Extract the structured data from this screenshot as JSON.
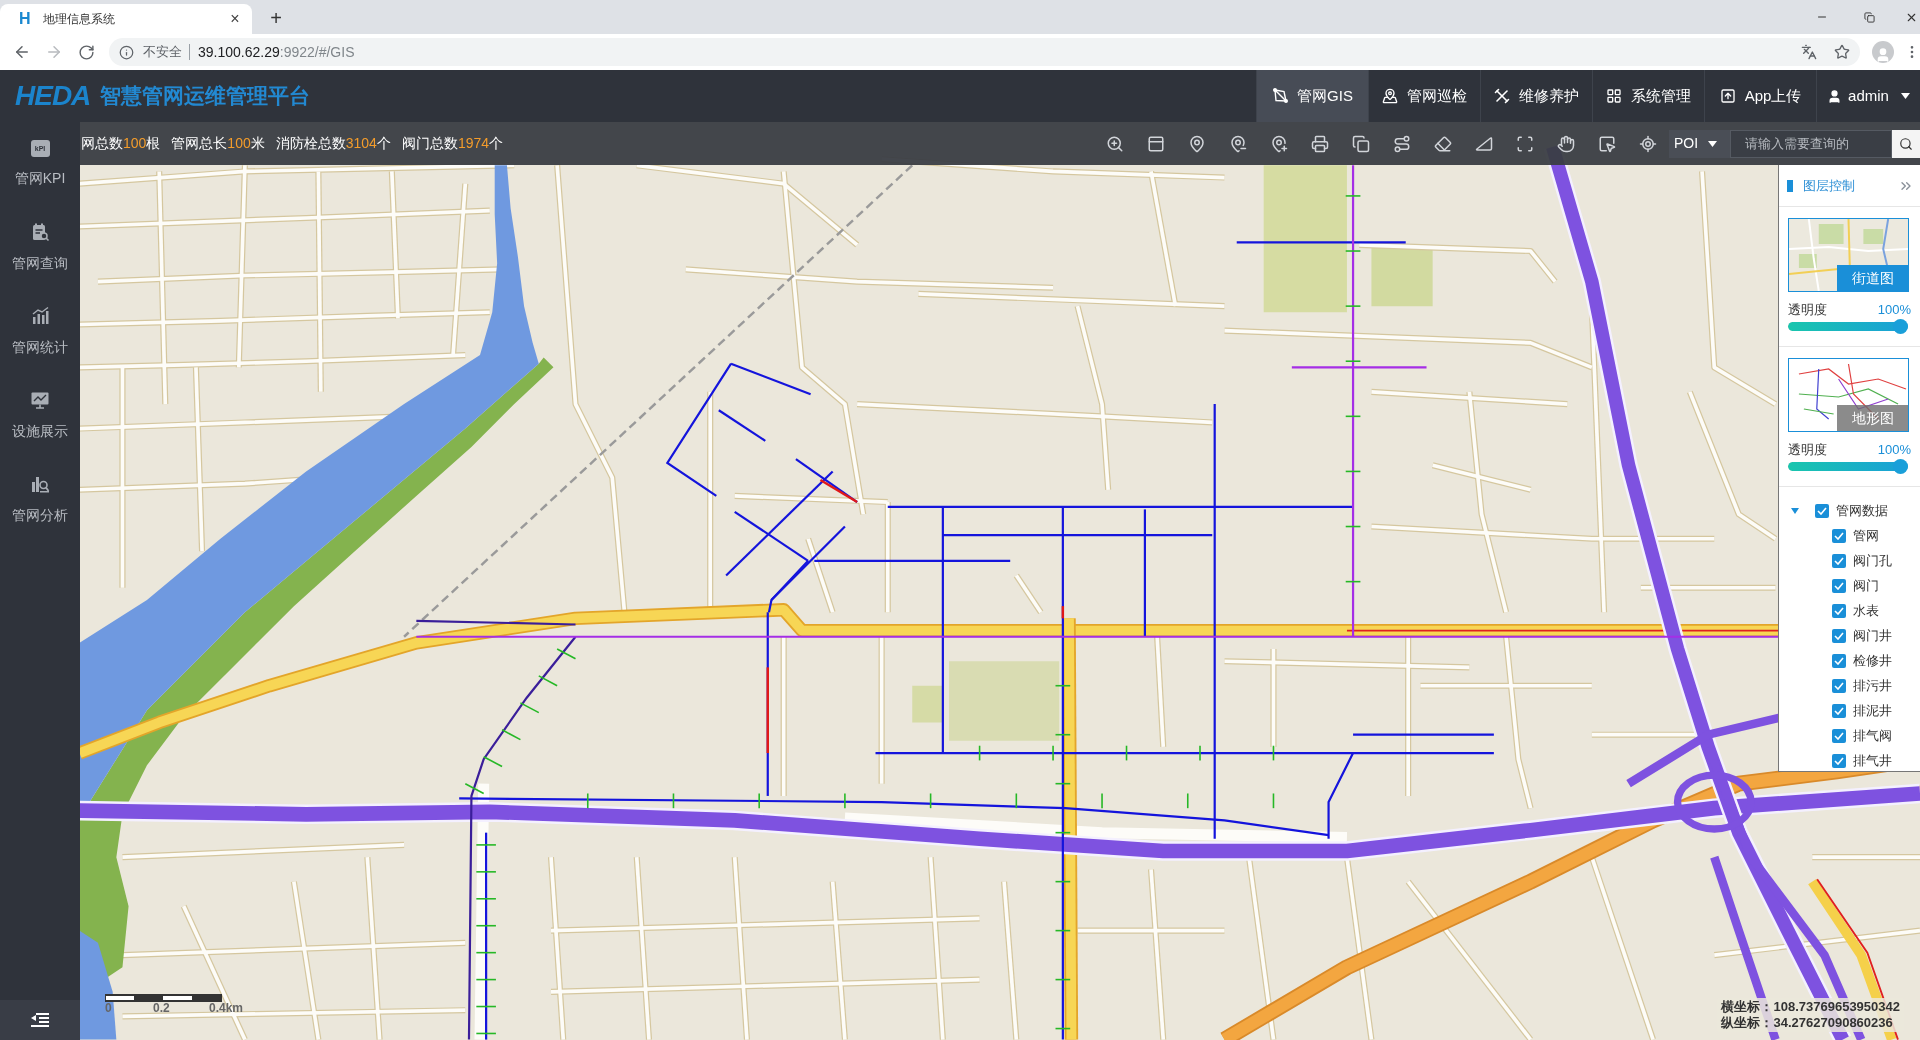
{
  "browser": {
    "tab": {
      "icon_letter": "H",
      "title": "地理信息系统",
      "close": "×",
      "selected": true
    },
    "new_tab": "+",
    "nav_buttons": [
      {
        "kind": "back",
        "disabled": false
      },
      {
        "kind": "forward",
        "disabled": true
      },
      {
        "kind": "reload",
        "disabled": false
      }
    ],
    "address": {
      "security": "不安全",
      "host": "39.100.62.29",
      "path": ":9922/#/GIS"
    }
  },
  "header": {
    "logo": "HEDA",
    "title": "智慧管网运维管理平台",
    "nav": [
      {
        "kind": "gis",
        "label": "管网GIS",
        "selected": true
      },
      {
        "kind": "patrol",
        "label": "管网巡检",
        "selected": false
      },
      {
        "kind": "maintenance",
        "label": "维修养护",
        "selected": false
      },
      {
        "kind": "system",
        "label": "系统管理",
        "selected": false
      },
      {
        "kind": "upload",
        "label": "App上传",
        "selected": false
      }
    ],
    "user": "admin"
  },
  "sidebar": {
    "items": [
      {
        "kind": "kpi",
        "icon_text": "kPI",
        "label": "管网KPI"
      },
      {
        "kind": "query",
        "label": "管网查询"
      },
      {
        "kind": "stats",
        "label": "管网统计"
      },
      {
        "kind": "display",
        "label": "设施展示"
      },
      {
        "kind": "analysis",
        "label": "管网分析"
      }
    ]
  },
  "stats": [
    {
      "label": "网总数",
      "value": "100",
      "unit": "根"
    },
    {
      "label": "管网总长",
      "value": "100",
      "unit": "米"
    },
    {
      "label": "消防栓总数",
      "value": "3104",
      "unit": "个"
    },
    {
      "label": "阀门总数",
      "value": "1974",
      "unit": "个"
    }
  ],
  "toolbar": [
    {
      "kind": "zoom_in"
    },
    {
      "kind": "full_extent"
    },
    {
      "kind": "pin"
    },
    {
      "kind": "pin_remove"
    },
    {
      "kind": "pin_add"
    },
    {
      "kind": "print"
    },
    {
      "kind": "overlay"
    },
    {
      "kind": "route"
    },
    {
      "kind": "erase"
    },
    {
      "kind": "measure"
    },
    {
      "kind": "frame"
    },
    {
      "kind": "pan"
    },
    {
      "kind": "select"
    },
    {
      "kind": "locate"
    }
  ],
  "search": {
    "scope": "POI",
    "placeholder": "请输入需要查询的"
  },
  "layer_panel": {
    "title": "图层控制",
    "basemaps": [
      {
        "kind": "street",
        "label": "街道图",
        "selected": true,
        "opacity_label": "透明度",
        "opacity": "100%",
        "level": 1
      },
      {
        "kind": "pipe",
        "label": "地形图",
        "selected": false,
        "opacity_label": "透明度",
        "opacity": "100%",
        "level": 1
      }
    ],
    "tree": [
      {
        "label": "管网数据",
        "checked": true,
        "expanded": true,
        "children": [
          {
            "label": "管网",
            "checked": true
          },
          {
            "label": "阀门孔",
            "checked": true
          },
          {
            "label": "阀门",
            "checked": true
          },
          {
            "label": "水表",
            "checked": true
          },
          {
            "label": "阀门井",
            "checked": true
          },
          {
            "label": "检修井",
            "checked": true
          },
          {
            "label": "排污井",
            "checked": true
          },
          {
            "label": "排泥井",
            "checked": true
          },
          {
            "label": "排气阀",
            "checked": true
          },
          {
            "label": "排气井",
            "checked": true
          }
        ]
      }
    ]
  },
  "scale_bar": {
    "labels": [
      "0",
      "0.2",
      "0.4km"
    ]
  },
  "coordinates": [
    {
      "label": "横坐标：",
      "value": "108.73769653950342"
    },
    {
      "label": "纵坐标：",
      "value": "34.27627090860236"
    }
  ]
}
